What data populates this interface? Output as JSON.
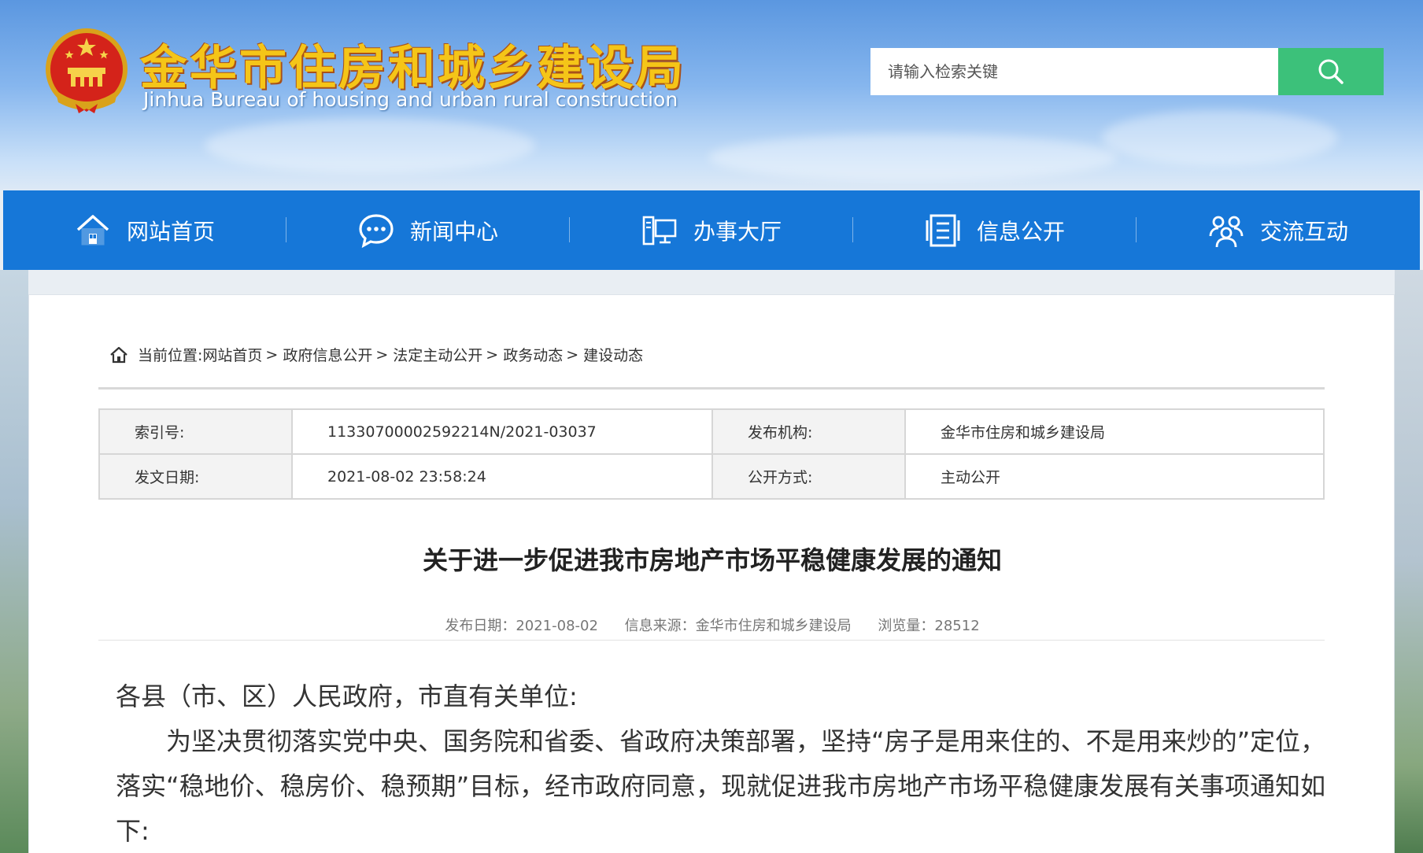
{
  "header": {
    "title_cn": "金华市住房和城乡建设局",
    "title_en": "Jinhua Bureau of housing and urban rural construction",
    "search_placeholder": "请输入检索关键"
  },
  "nav": {
    "items": [
      {
        "label": "网站首页",
        "icon": "home-icon"
      },
      {
        "label": "新闻中心",
        "icon": "chat-bubble-icon"
      },
      {
        "label": "办事大厅",
        "icon": "computer-icon"
      },
      {
        "label": "信息公开",
        "icon": "document-list-icon"
      },
      {
        "label": "交流互动",
        "icon": "users-icon"
      }
    ]
  },
  "breadcrumb": {
    "prefix": "当前位置:",
    "items": [
      "网站首页",
      "政府信息公开",
      "法定主动公开",
      "政务动态",
      "建设动态"
    ],
    "separator": ">"
  },
  "meta": {
    "index_label": "索引号:",
    "index_value": "11330700002592214N/2021-03037",
    "publisher_label": "发布机构:",
    "publisher_value": "金华市住房和城乡建设局",
    "date_label": "发文日期:",
    "date_value": "2021-08-02 23:58:24",
    "method_label": "公开方式:",
    "method_value": "主动公开"
  },
  "article": {
    "title": "关于进一步促进我市房地产市场平稳健康发展的通知",
    "publish_date": "发布日期：2021-08-02",
    "source": "信息来源：金华市住房和城乡建设局",
    "views": "浏览量：28512",
    "salutation": "各县（市、区）人民政府，市直有关单位:",
    "paragraph1": "为坚决贯彻落实党中央、国务院和省委、省政府决策部署，坚持“房子是用来住的、不是用来炒的”定位，落实“稳地价、稳房价、稳预期”目标，经市政府同意，现就促进我市房地产市场平稳健康发展有关事项通知如下:"
  },
  "colors": {
    "nav_bg": "#1677d8",
    "search_btn": "#3cc17a",
    "title_gold": "#f5c518"
  }
}
